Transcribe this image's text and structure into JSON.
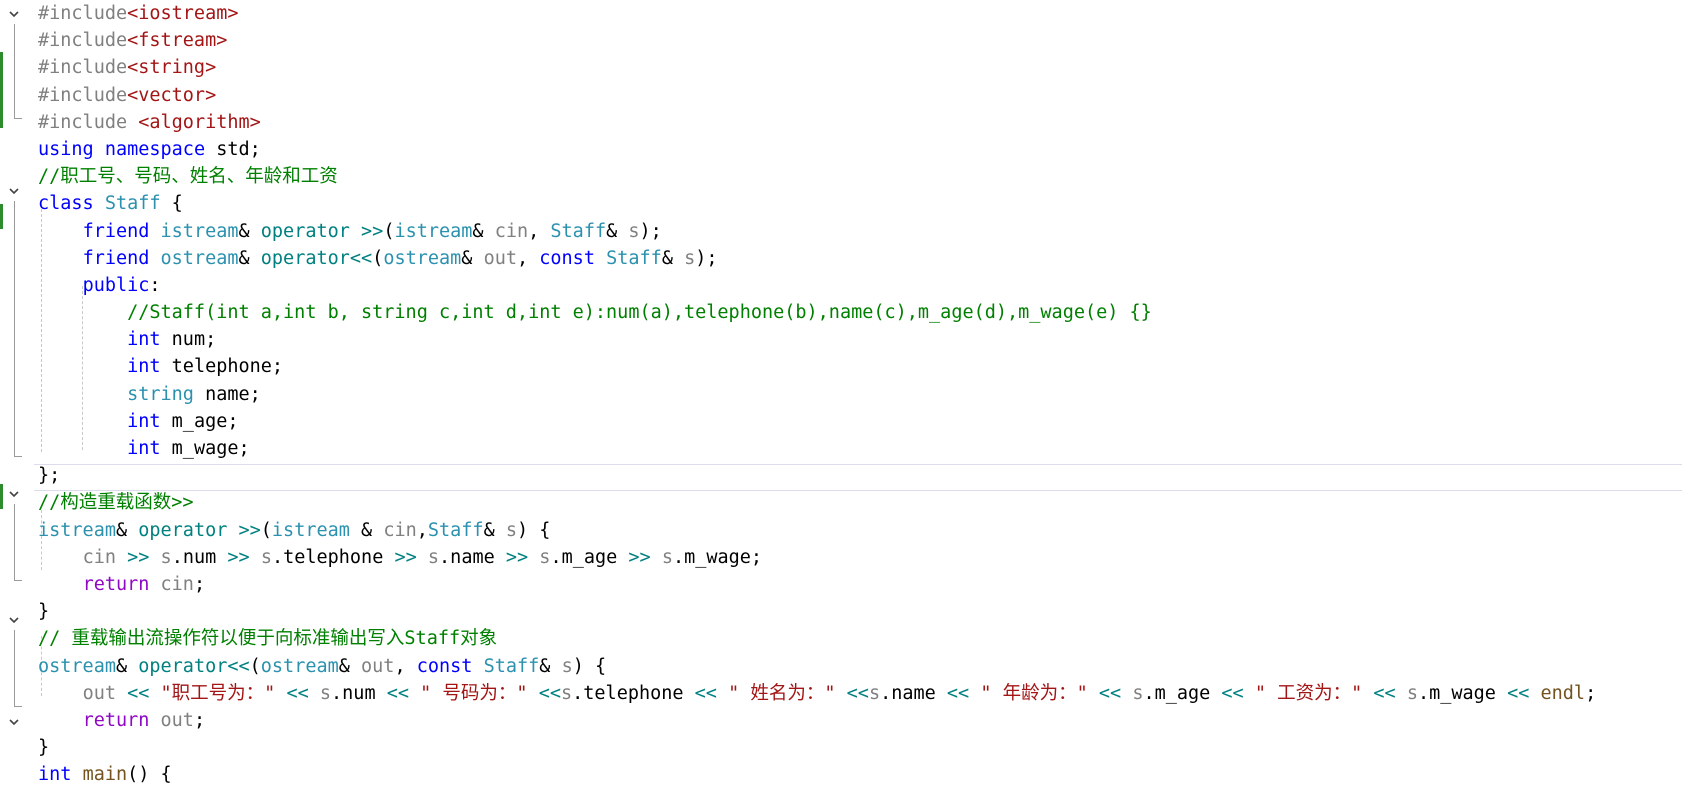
{
  "editor": {
    "lines": [
      [
        {
          "t": "#include",
          "c": "pp"
        },
        {
          "t": "<iostream>",
          "c": "st"
        }
      ],
      [
        {
          "t": "#include",
          "c": "pp"
        },
        {
          "t": "<fstream>",
          "c": "st"
        }
      ],
      [
        {
          "t": "#include",
          "c": "pp"
        },
        {
          "t": "<string>",
          "c": "st"
        }
      ],
      [
        {
          "t": "#include",
          "c": "pp"
        },
        {
          "t": "<vector>",
          "c": "st"
        }
      ],
      [
        {
          "t": "#include ",
          "c": "pp"
        },
        {
          "t": "<algorithm>",
          "c": "st"
        }
      ],
      [
        {
          "t": "using",
          "c": "kw"
        },
        {
          "t": " ",
          "c": ""
        },
        {
          "t": "namespace",
          "c": "kw"
        },
        {
          "t": " std;",
          "c": ""
        }
      ],
      [
        {
          "t": "//职工号、号码、姓名、年龄和工资",
          "c": "cm"
        }
      ],
      [
        {
          "t": "class",
          "c": "kw"
        },
        {
          "t": " ",
          "c": ""
        },
        {
          "t": "Staff",
          "c": "ty"
        },
        {
          "t": " {",
          "c": ""
        }
      ],
      [
        {
          "t": "    ",
          "c": ""
        },
        {
          "t": "friend",
          "c": "kw"
        },
        {
          "t": " ",
          "c": ""
        },
        {
          "t": "istream",
          "c": "ty"
        },
        {
          "t": "& ",
          "c": ""
        },
        {
          "t": "operator >>",
          "c": "op"
        },
        {
          "t": "(",
          "c": ""
        },
        {
          "t": "istream",
          "c": "ty"
        },
        {
          "t": "& ",
          "c": ""
        },
        {
          "t": "cin",
          "c": "pr"
        },
        {
          "t": ", ",
          "c": ""
        },
        {
          "t": "Staff",
          "c": "ty"
        },
        {
          "t": "& ",
          "c": ""
        },
        {
          "t": "s",
          "c": "pr"
        },
        {
          "t": ");",
          "c": ""
        }
      ],
      [
        {
          "t": "    ",
          "c": ""
        },
        {
          "t": "friend",
          "c": "kw"
        },
        {
          "t": " ",
          "c": ""
        },
        {
          "t": "ostream",
          "c": "ty"
        },
        {
          "t": "& ",
          "c": ""
        },
        {
          "t": "operator<<",
          "c": "op"
        },
        {
          "t": "(",
          "c": ""
        },
        {
          "t": "ostream",
          "c": "ty"
        },
        {
          "t": "& ",
          "c": ""
        },
        {
          "t": "out",
          "c": "pr"
        },
        {
          "t": ", ",
          "c": ""
        },
        {
          "t": "const",
          "c": "kw"
        },
        {
          "t": " ",
          "c": ""
        },
        {
          "t": "Staff",
          "c": "ty"
        },
        {
          "t": "& ",
          "c": ""
        },
        {
          "t": "s",
          "c": "pr"
        },
        {
          "t": ");",
          "c": ""
        }
      ],
      [
        {
          "t": "    ",
          "c": ""
        },
        {
          "t": "public",
          "c": "kw"
        },
        {
          "t": ":",
          "c": ""
        }
      ],
      [
        {
          "t": "        ",
          "c": ""
        },
        {
          "t": "//Staff(int a,int b, string c,int d,int e):num(a),telephone(b),name(c),m_age(d),m_wage(e) {}",
          "c": "cm"
        }
      ],
      [
        {
          "t": "        ",
          "c": ""
        },
        {
          "t": "int",
          "c": "kw"
        },
        {
          "t": " num;",
          "c": ""
        }
      ],
      [
        {
          "t": "        ",
          "c": ""
        },
        {
          "t": "int",
          "c": "kw"
        },
        {
          "t": " telephone;",
          "c": ""
        }
      ],
      [
        {
          "t": "        ",
          "c": ""
        },
        {
          "t": "string",
          "c": "ty"
        },
        {
          "t": " name;",
          "c": ""
        }
      ],
      [
        {
          "t": "        ",
          "c": ""
        },
        {
          "t": "int",
          "c": "kw"
        },
        {
          "t": " m_age;",
          "c": ""
        }
      ],
      [
        {
          "t": "        ",
          "c": ""
        },
        {
          "t": "int",
          "c": "kw"
        },
        {
          "t": " m_wage;",
          "c": ""
        }
      ],
      [
        {
          "t": "};",
          "c": ""
        }
      ],
      [
        {
          "t": "//构造重载函数>>",
          "c": "cm"
        }
      ],
      [
        {
          "t": "istream",
          "c": "ty"
        },
        {
          "t": "& ",
          "c": ""
        },
        {
          "t": "operator >>",
          "c": "op"
        },
        {
          "t": "(",
          "c": ""
        },
        {
          "t": "istream",
          "c": "ty"
        },
        {
          "t": " & ",
          "c": ""
        },
        {
          "t": "cin",
          "c": "pr"
        },
        {
          "t": ",",
          "c": ""
        },
        {
          "t": "Staff",
          "c": "ty"
        },
        {
          "t": "& ",
          "c": ""
        },
        {
          "t": "s",
          "c": "pr"
        },
        {
          "t": ") {",
          "c": ""
        }
      ],
      [
        {
          "t": "    ",
          "c": ""
        },
        {
          "t": "cin",
          "c": "pr"
        },
        {
          "t": " ",
          "c": ""
        },
        {
          "t": ">>",
          "c": "op"
        },
        {
          "t": " ",
          "c": ""
        },
        {
          "t": "s",
          "c": "pr"
        },
        {
          "t": ".num ",
          "c": ""
        },
        {
          "t": ">>",
          "c": "op"
        },
        {
          "t": " ",
          "c": ""
        },
        {
          "t": "s",
          "c": "pr"
        },
        {
          "t": ".telephone ",
          "c": ""
        },
        {
          "t": ">>",
          "c": "op"
        },
        {
          "t": " ",
          "c": ""
        },
        {
          "t": "s",
          "c": "pr"
        },
        {
          "t": ".name ",
          "c": ""
        },
        {
          "t": ">>",
          "c": "op"
        },
        {
          "t": " ",
          "c": ""
        },
        {
          "t": "s",
          "c": "pr"
        },
        {
          "t": ".m_age ",
          "c": ""
        },
        {
          "t": ">>",
          "c": "op"
        },
        {
          "t": " ",
          "c": ""
        },
        {
          "t": "s",
          "c": "pr"
        },
        {
          "t": ".m_wage;",
          "c": ""
        }
      ],
      [
        {
          "t": "    ",
          "c": ""
        },
        {
          "t": "return",
          "c": "ct"
        },
        {
          "t": " ",
          "c": ""
        },
        {
          "t": "cin",
          "c": "pr"
        },
        {
          "t": ";",
          "c": ""
        }
      ],
      [
        {
          "t": "}",
          "c": ""
        }
      ],
      [
        {
          "t": "// 重载输出流操作符以便于向标准输出写入Staff对象",
          "c": "cm"
        }
      ],
      [
        {
          "t": "ostream",
          "c": "ty"
        },
        {
          "t": "& ",
          "c": ""
        },
        {
          "t": "operator<<",
          "c": "op"
        },
        {
          "t": "(",
          "c": ""
        },
        {
          "t": "ostream",
          "c": "ty"
        },
        {
          "t": "& ",
          "c": ""
        },
        {
          "t": "out",
          "c": "pr"
        },
        {
          "t": ", ",
          "c": ""
        },
        {
          "t": "const",
          "c": "kw"
        },
        {
          "t": " ",
          "c": ""
        },
        {
          "t": "Staff",
          "c": "ty"
        },
        {
          "t": "& ",
          "c": ""
        },
        {
          "t": "s",
          "c": "pr"
        },
        {
          "t": ") {",
          "c": ""
        }
      ],
      [
        {
          "t": "    ",
          "c": ""
        },
        {
          "t": "out",
          "c": "pr"
        },
        {
          "t": " ",
          "c": ""
        },
        {
          "t": "<<",
          "c": "op"
        },
        {
          "t": " ",
          "c": ""
        },
        {
          "t": "\"职工号为：\"",
          "c": "st"
        },
        {
          "t": " ",
          "c": ""
        },
        {
          "t": "<<",
          "c": "op"
        },
        {
          "t": " ",
          "c": ""
        },
        {
          "t": "s",
          "c": "pr"
        },
        {
          "t": ".num ",
          "c": ""
        },
        {
          "t": "<<",
          "c": "op"
        },
        {
          "t": " ",
          "c": ""
        },
        {
          "t": "\" 号码为：\"",
          "c": "st"
        },
        {
          "t": " ",
          "c": ""
        },
        {
          "t": "<<",
          "c": "op"
        },
        {
          "t": "s",
          "c": "pr"
        },
        {
          "t": ".telephone ",
          "c": ""
        },
        {
          "t": "<<",
          "c": "op"
        },
        {
          "t": " ",
          "c": ""
        },
        {
          "t": "\" 姓名为：\"",
          "c": "st"
        },
        {
          "t": " ",
          "c": ""
        },
        {
          "t": "<<",
          "c": "op"
        },
        {
          "t": "s",
          "c": "pr"
        },
        {
          "t": ".name ",
          "c": ""
        },
        {
          "t": "<<",
          "c": "op"
        },
        {
          "t": " ",
          "c": ""
        },
        {
          "t": "\" 年龄为：\"",
          "c": "st"
        },
        {
          "t": " ",
          "c": ""
        },
        {
          "t": "<<",
          "c": "op"
        },
        {
          "t": " ",
          "c": ""
        },
        {
          "t": "s",
          "c": "pr"
        },
        {
          "t": ".m_age ",
          "c": ""
        },
        {
          "t": "<<",
          "c": "op"
        },
        {
          "t": " ",
          "c": ""
        },
        {
          "t": "\" 工资为：\"",
          "c": "st"
        },
        {
          "t": " ",
          "c": ""
        },
        {
          "t": "<<",
          "c": "op"
        },
        {
          "t": " ",
          "c": ""
        },
        {
          "t": "s",
          "c": "pr"
        },
        {
          "t": ".m_wage ",
          "c": ""
        },
        {
          "t": "<<",
          "c": "op"
        },
        {
          "t": " ",
          "c": ""
        },
        {
          "t": "endl",
          "c": "fn"
        },
        {
          "t": ";",
          "c": ""
        }
      ],
      [
        {
          "t": "    ",
          "c": ""
        },
        {
          "t": "return",
          "c": "ct"
        },
        {
          "t": " ",
          "c": ""
        },
        {
          "t": "out",
          "c": "pr"
        },
        {
          "t": ";",
          "c": ""
        }
      ],
      [
        {
          "t": "}",
          "c": ""
        }
      ],
      [
        {
          "t": "int",
          "c": "kw"
        },
        {
          "t": " ",
          "c": ""
        },
        {
          "t": "main",
          "c": "fn"
        },
        {
          "t": "() {",
          "c": ""
        }
      ]
    ]
  }
}
